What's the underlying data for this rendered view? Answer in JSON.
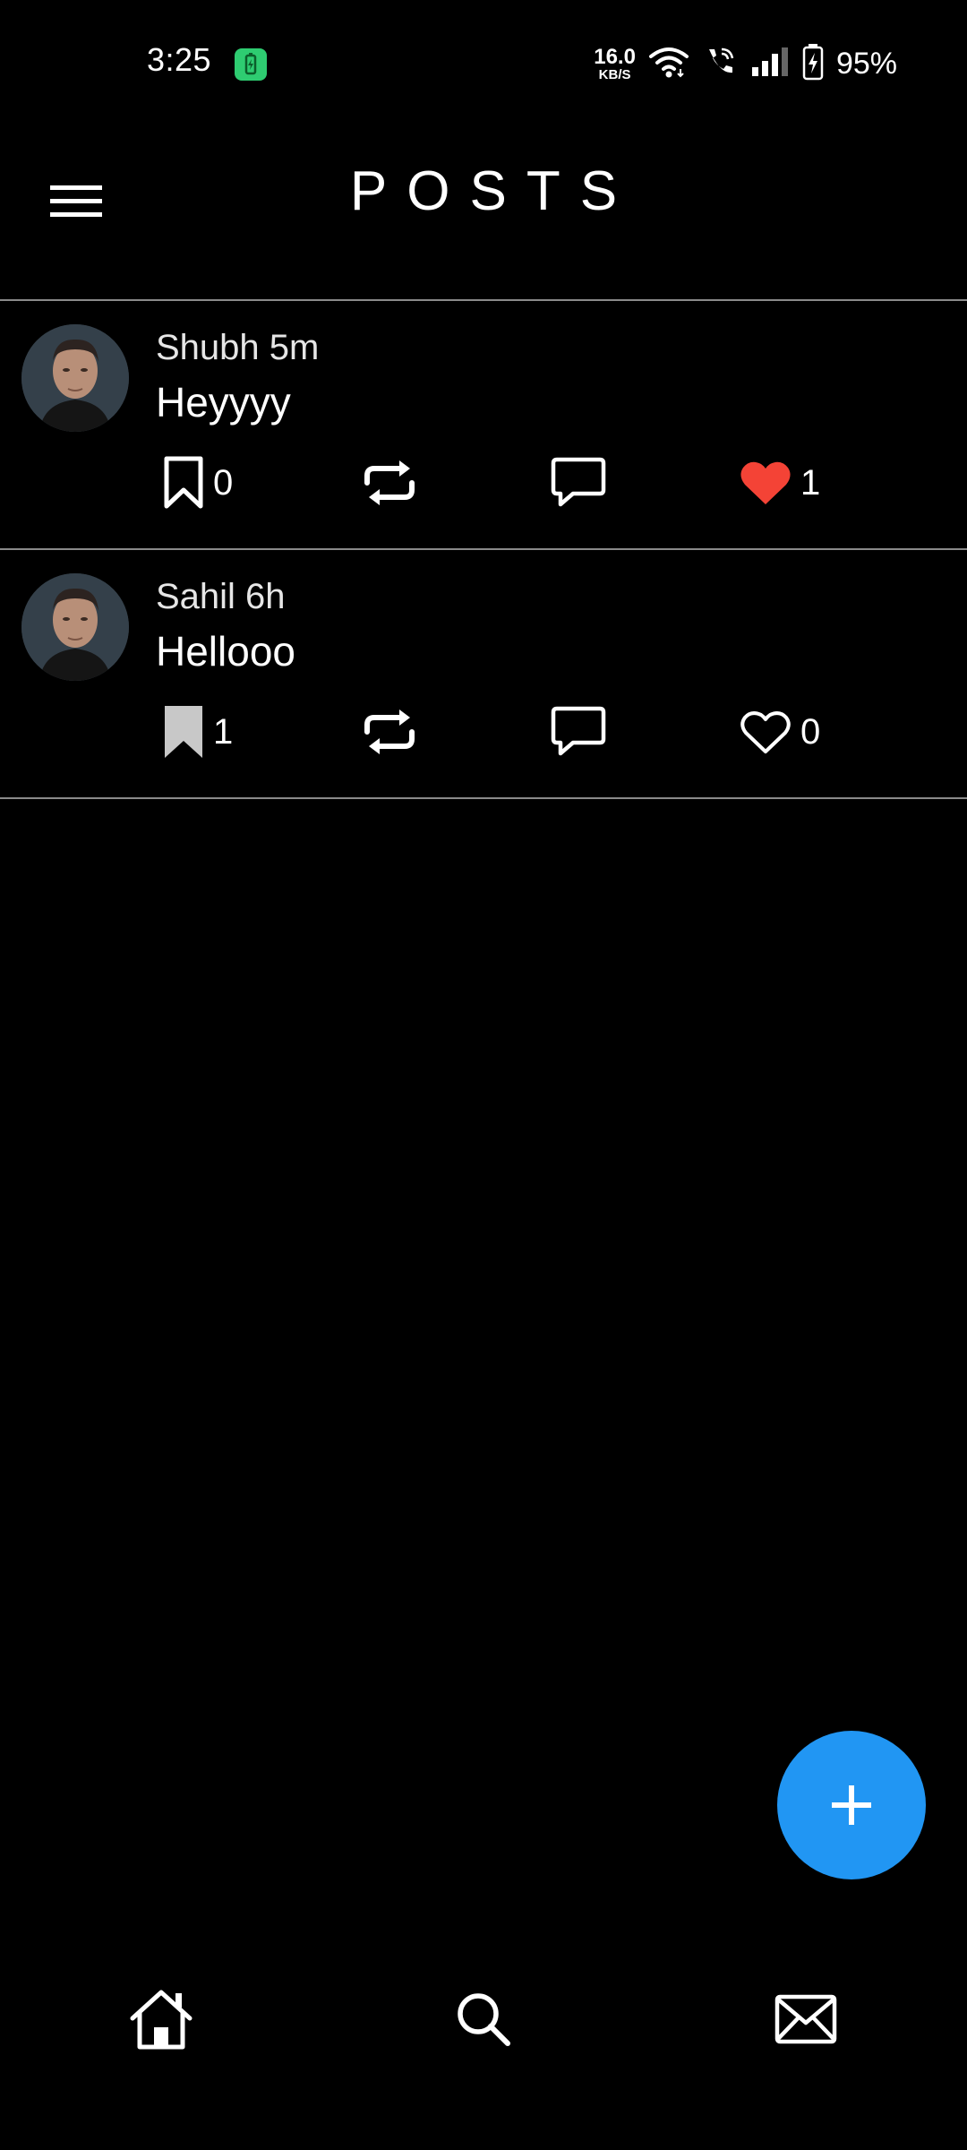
{
  "status_bar": {
    "time": "3:25",
    "net_speed_value": "16.0",
    "net_speed_unit": "KB/S",
    "battery_percent": "95%"
  },
  "header": {
    "title": "POSTS",
    "menu_icon": "hamburger-menu-icon"
  },
  "posts": [
    {
      "author": "Shubh",
      "time_ago": "5m",
      "meta": "Shubh 5m",
      "text": "Heyyyy",
      "bookmark_count": "0",
      "bookmarked": false,
      "liked": true,
      "like_count": "1"
    },
    {
      "author": "Sahil",
      "time_ago": "6h",
      "meta": "Sahil 6h",
      "text": "Hellooo",
      "bookmark_count": "1",
      "bookmarked": true,
      "liked": false,
      "like_count": "0"
    }
  ],
  "fab": {
    "icon": "plus-icon"
  },
  "bottom_nav": {
    "items": [
      "home-icon",
      "search-icon",
      "mail-icon"
    ]
  },
  "colors": {
    "background": "#000000",
    "accent": "#2196f3",
    "like_active": "#f44336",
    "divider": "#8a8a8a"
  }
}
